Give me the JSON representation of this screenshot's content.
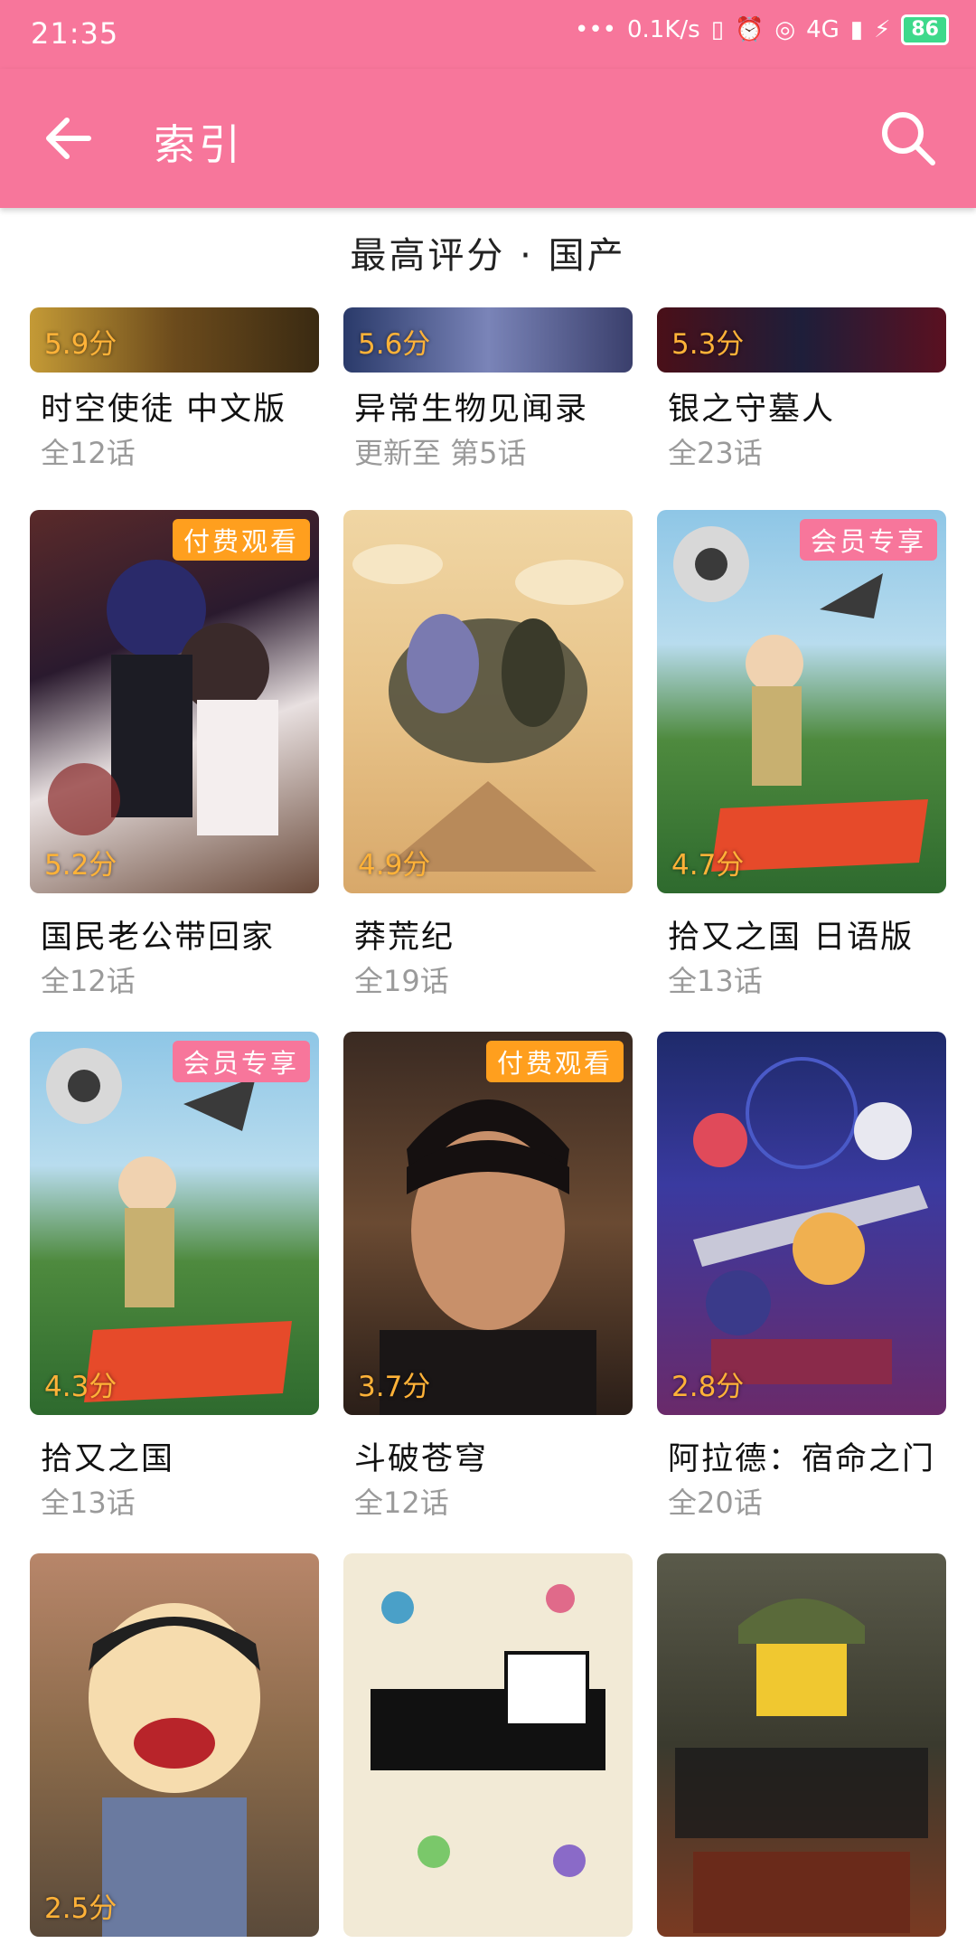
{
  "status_bar": {
    "time": "21:35",
    "network_speed": "0.1K/s",
    "network_type": "4G",
    "battery": "86"
  },
  "app_bar": {
    "title": "索引"
  },
  "subheader": "最高评分 · 国产",
  "cards": [
    {
      "score": "5.9分",
      "title": "时空使徒 中文版",
      "episodes": "全12话"
    },
    {
      "score": "5.6分",
      "title": "异常生物见闻录",
      "episodes": "更新至 第5话"
    },
    {
      "score": "5.3分",
      "title": "银之守墓人",
      "episodes": "全23话"
    },
    {
      "score": "5.2分",
      "title": "国民老公带回家",
      "episodes": "全12话",
      "badge": "付费观看"
    },
    {
      "score": "4.9分",
      "title": "莽荒纪",
      "episodes": "全19话"
    },
    {
      "score": "4.7分",
      "title": "拾又之国 日语版",
      "episodes": "全13话",
      "badge": "会员专享"
    },
    {
      "score": "4.3分",
      "title": "拾又之国",
      "episodes": "全13话",
      "badge": "会员专享"
    },
    {
      "score": "3.7分",
      "title": "斗破苍穹",
      "episodes": "全12话",
      "badge": "付费观看"
    },
    {
      "score": "2.8分",
      "title": "阿拉德：宿命之门",
      "episodes": "全20话"
    },
    {
      "score": "2.5分"
    },
    {
      "score": ""
    },
    {
      "score": ""
    }
  ],
  "colors": {
    "accent": "#f7769b",
    "score": "#ffb238",
    "paid_badge": "#ff9f1e",
    "member_badge": "#f7769b"
  },
  "icons": {
    "back": "arrow-left-icon",
    "search": "search-icon"
  }
}
